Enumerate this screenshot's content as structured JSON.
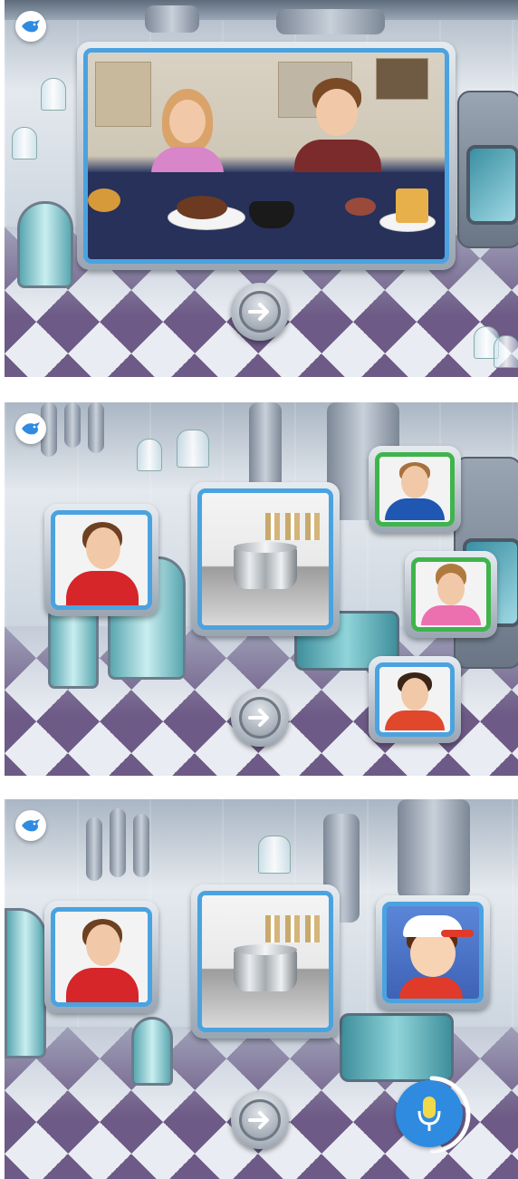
{
  "app": {
    "back_icon": "bird-back-icon",
    "next_icon": "arrow-right-icon",
    "mic_icon": "microphone-icon",
    "accent": "#4aa3e0",
    "correct_accent": "#3fb44c",
    "mic_color": "#2f8be0"
  },
  "screens": [
    {
      "id": "video",
      "main_image": "kids-at-kitchen-table-photo"
    },
    {
      "id": "choose",
      "center_image": "cooking-pot-photo",
      "left_image": "boy-red-shirt-portrait",
      "right_images": [
        "boy-blue-shirt-portrait",
        "girl-pink-shirt-portrait",
        "boy-red-shirt-portrait-2"
      ]
    },
    {
      "id": "speak",
      "center_image": "cooking-pot-photo",
      "left_image": "boy-red-shirt-portrait",
      "right_image": "cartoon-boy-white-cap",
      "mic_level": 0.5
    }
  ]
}
